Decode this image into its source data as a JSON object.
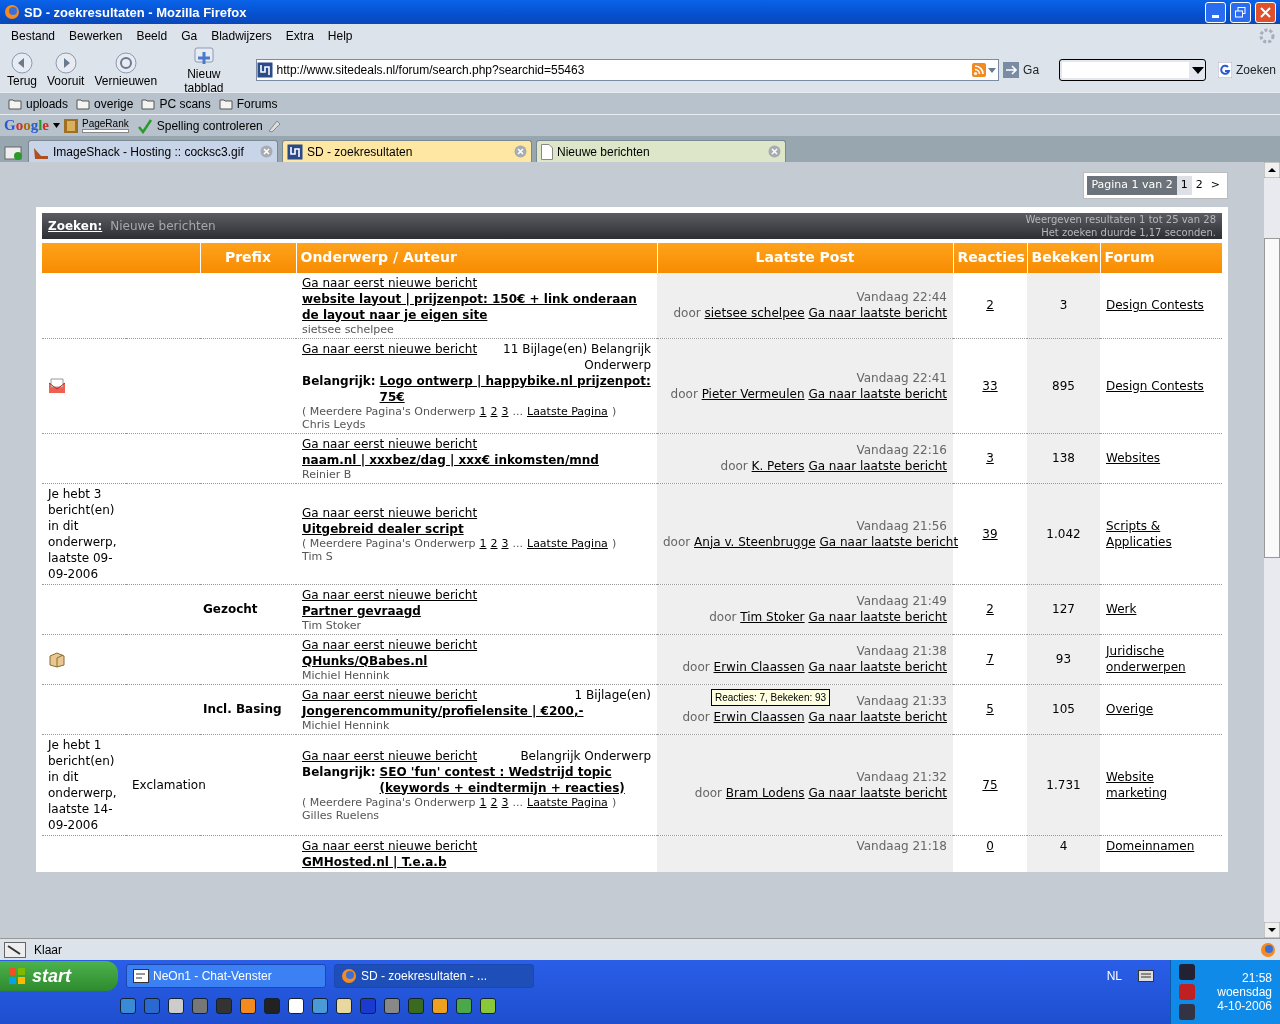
{
  "window": {
    "title": "SD - zoekresultaten - Mozilla Firefox"
  },
  "menu": [
    "Bestand",
    "Bewerken",
    "Beeld",
    "Ga",
    "Bladwijzers",
    "Extra",
    "Help"
  ],
  "nav_buttons": [
    {
      "label": "Terug",
      "kind": "back"
    },
    {
      "label": "Vooruit",
      "kind": "forward"
    },
    {
      "label": "Vernieuwen",
      "kind": "reload"
    },
    {
      "label": "Nieuw tabblad",
      "kind": "newtab"
    }
  ],
  "address": {
    "value": "http://www.sitedeals.nl/forum/search.php?searchid=55463",
    "go": "Ga"
  },
  "search": {
    "button": "Zoeken"
  },
  "bookmarks": [
    "uploads",
    "overige",
    "PC scans",
    "Forums"
  ],
  "google_bar": {
    "logo": "Google",
    "pagerank": "PageRank",
    "spell": "Spelling controleren"
  },
  "tabs": [
    {
      "label": "ImageShack - Hosting :: cocksc3.gif",
      "selected": false
    },
    {
      "label": "SD - zoekresultaten",
      "selected": true
    },
    {
      "label": "Nieuwe berichten",
      "selected": false
    }
  ],
  "pagination": {
    "label": "Pagina 1 van 2",
    "pages": [
      {
        "label": "1",
        "selected": true
      },
      {
        "label": "2",
        "selected": false
      }
    ],
    "next": ">"
  },
  "results_header": {
    "title": "Zoeken:",
    "subtitle": "Nieuwe berichten",
    "info": [
      "Weergeven resultaten 1 tot 25 van 28",
      "Het zoeken duurde 1,17 seconden."
    ]
  },
  "table": {
    "columns": [
      "Prefix",
      "Onderwerp / Auteur",
      "Laatste Post",
      "Reacties",
      "Bekeken",
      "Forum"
    ],
    "rows": [
      {
        "first_new": "Ga naar eerst nieuwe bericht",
        "title": "website layout | prijzenpot: 150€ + link onderaan de layout naar je eigen site",
        "author": "sietsee schelpee",
        "last_post": {
          "date": "Vandaag 22:44",
          "by_label": "door",
          "by": "sietsee schelpee",
          "goto": "Ga naar laatste bericht"
        },
        "replies": "2",
        "views": "3",
        "forum": "Design Contests"
      },
      {
        "status": {
          "kind": "envelope"
        },
        "first_new": "Ga naar eerst nieuwe bericht",
        "info": "11 Bijlage(en) Belangrijk Onderwerp",
        "important": "Belangrijk:",
        "title": "Logo ontwerp | happybike.nl prijzenpot: 75€",
        "pages": {
          "label": "( Meerdere Pagina's Onderwerp",
          "numbers": [
            "1",
            "2",
            "3"
          ],
          "ellipsis": "...",
          "last": "Laatste Pagina",
          "close": ")"
        },
        "author": "Chris Leyds",
        "last_post": {
          "date": "Vandaag 22:41",
          "by_label": "door",
          "by": "Pieter Vermeulen",
          "goto": "Ga naar laatste bericht"
        },
        "replies": "33",
        "views": "895",
        "forum": "Design Contests"
      },
      {
        "first_new": "Ga naar eerst nieuwe bericht",
        "title": "naam.nl | xxxbez/dag | xxx€ inkomsten/mnd",
        "author": "Reinier B",
        "last_post": {
          "date": "Vandaag 22:16",
          "by_label": "door",
          "by": "K. Peters",
          "goto": "Ga naar laatste bericht"
        },
        "replies": "3",
        "views": "138",
        "forum": "Websites"
      },
      {
        "status": {
          "kind": "text",
          "text": "Je hebt 3 bericht(en) in dit onderwerp, laatste 09-09-2006"
        },
        "first_new": "Ga naar eerst nieuwe bericht",
        "title": "Uitgebreid dealer script",
        "pages": {
          "label": "( Meerdere Pagina's Onderwerp",
          "numbers": [
            "1",
            "2",
            "3"
          ],
          "ellipsis": "...",
          "last": "Laatste Pagina",
          "close": ")"
        },
        "author": "Tim S",
        "last_post": {
          "date": "Vandaag 21:56",
          "by_label": "door",
          "by": "Anja v. Steenbrugge",
          "goto": "Ga naar laatste bericht"
        },
        "replies": "39",
        "views": "1.042",
        "forum": "Scripts & Applicaties"
      },
      {
        "prefix": "Gezocht",
        "first_new": "Ga naar eerst nieuwe bericht",
        "title": "Partner gevraagd",
        "author": "Tim Stoker",
        "last_post": {
          "date": "Vandaag 21:49",
          "by_label": "door",
          "by": "Tim Stoker",
          "goto": "Ga naar laatste bericht"
        },
        "replies": "2",
        "views": "127",
        "forum": "Werk"
      },
      {
        "status": {
          "kind": "package"
        },
        "first_new": "Ga naar eerst nieuwe bericht",
        "title": "QHunks/QBabes.nl",
        "author": "Michiel Hennink",
        "last_post": {
          "date": "Vandaag 21:38",
          "by_label": "door",
          "by": "Erwin Claassen",
          "goto": "Ga naar laatste bericht"
        },
        "replies": "7",
        "views": "93",
        "forum": "Juridische onderwerpen"
      },
      {
        "prefix": "Incl. Basing",
        "first_new": "Ga naar eerst nieuwe bericht",
        "info": "1 Bijlage(en)",
        "title": "Jongerencommunity/profielensite | €200,-",
        "author": "Michiel Hennink",
        "last_post": {
          "date": "Vandaag 21:33",
          "by_label": "door",
          "by": "Erwin Claassen",
          "goto": "Ga naar laatste bericht"
        },
        "replies": "5",
        "views": "105",
        "forum": "Overige",
        "tooltip": "Reacties: 7, Bekeken: 93"
      },
      {
        "status": {
          "kind": "text",
          "text": "Je hebt 1 bericht(en) in dit onderwerp, laatste 14-09-2006"
        },
        "icon_text": "Exclamation",
        "first_new": "Ga naar eerst nieuwe bericht",
        "info": "Belangrijk Onderwerp",
        "important": "Belangrijk:",
        "title": "SEO 'fun' contest : Wedstrijd topic (keywords + eindtermijn + reacties)",
        "pages": {
          "label": "( Meerdere Pagina's Onderwerp",
          "numbers": [
            "1",
            "2",
            "3"
          ],
          "ellipsis": "...",
          "last": "Laatste Pagina",
          "close": ")"
        },
        "author": "Gilles Ruelens",
        "last_post": {
          "date": "Vandaag 21:32",
          "by_label": "door",
          "by": "Bram Lodens",
          "goto": "Ga naar laatste bericht"
        },
        "replies": "75",
        "views": "1.731",
        "forum": "Website marketing"
      },
      {
        "first_new": "Ga naar eerst nieuwe bericht",
        "title": "GMHosted.nl | T.e.a.b",
        "last_post": {
          "date": "Vandaag 21:18"
        },
        "replies": "0",
        "views": "4",
        "forum": "Domeinnamen"
      }
    ]
  },
  "status_bar": {
    "text": "Klaar"
  },
  "taskbar": {
    "start": "start",
    "tasks": [
      {
        "label": "NeOn1 - Chat-Venster",
        "selected": false
      },
      {
        "label": "SD - zoekresultaten - ...",
        "selected": true
      }
    ],
    "language": "NL",
    "time": "21:58",
    "day": "woensdag",
    "date": "4-10-2006"
  }
}
